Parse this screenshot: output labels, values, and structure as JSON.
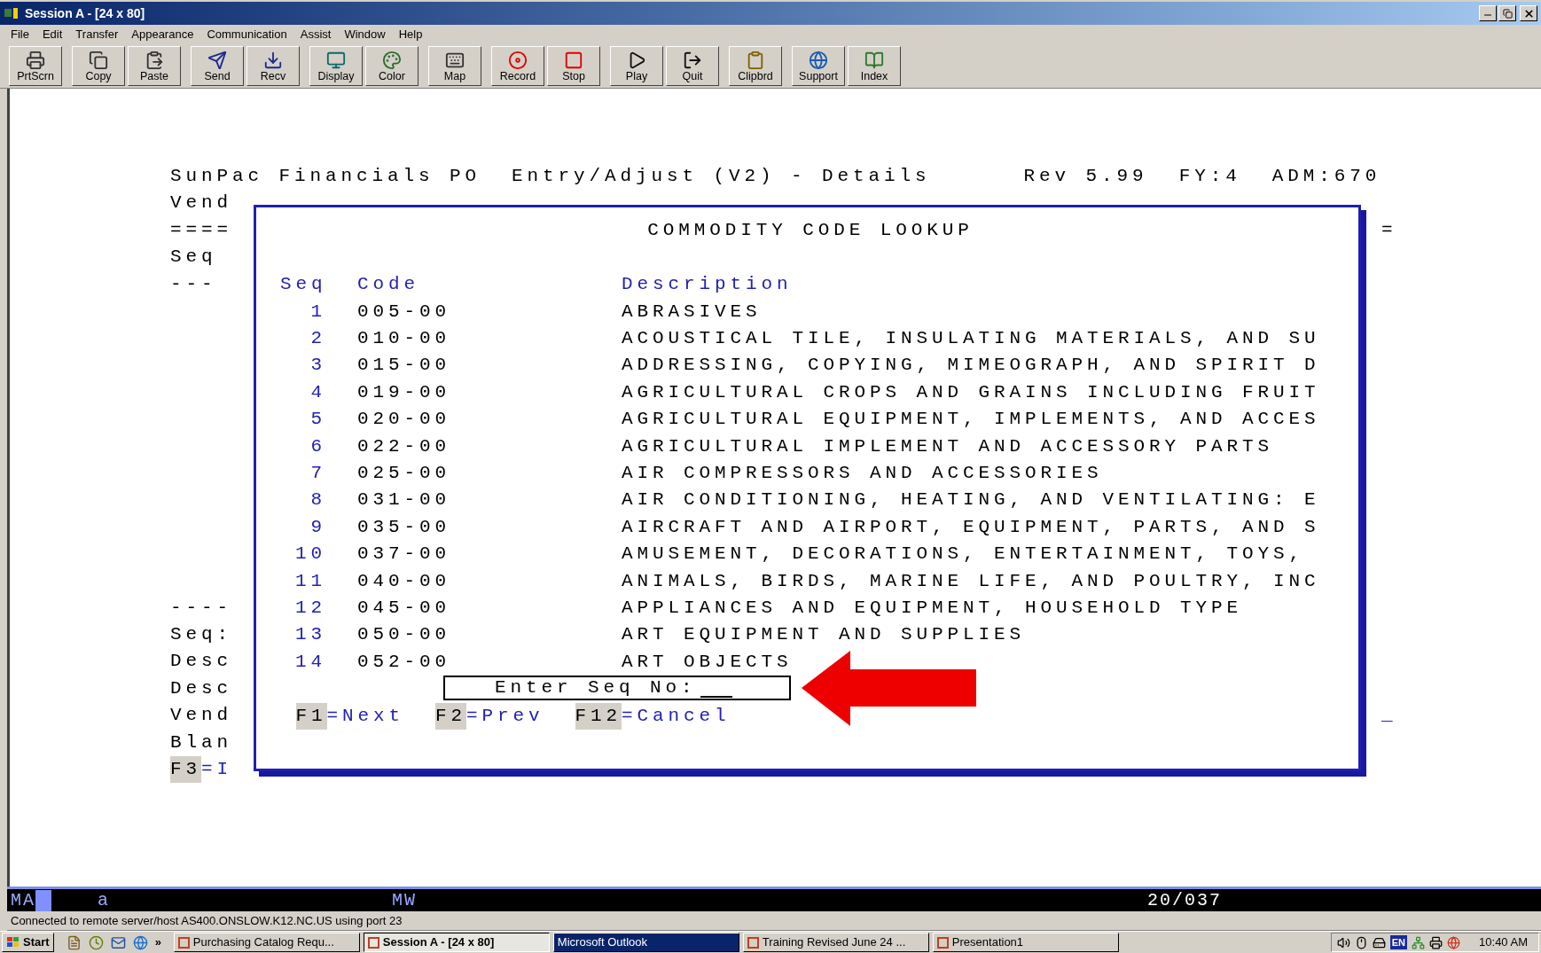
{
  "window": {
    "title": "Session A - [24 x 80]"
  },
  "menu": [
    "File",
    "Edit",
    "Transfer",
    "Appearance",
    "Communication",
    "Assist",
    "Window",
    "Help"
  ],
  "toolbar_groups": [
    {
      "buttons": [
        "PrtScrn"
      ]
    },
    {
      "buttons": [
        "Copy",
        "Paste"
      ]
    },
    {
      "buttons": [
        "Send",
        "Recv"
      ]
    },
    {
      "buttons": [
        "Display",
        "Color"
      ]
    },
    {
      "buttons": [
        "Map"
      ]
    },
    {
      "buttons": [
        "Record",
        "Stop"
      ]
    },
    {
      "buttons": [
        "Play",
        "Quit"
      ]
    },
    {
      "buttons": [
        "Clipbrd"
      ]
    },
    {
      "buttons": [
        "Support",
        "Index"
      ]
    }
  ],
  "screen": {
    "header": {
      "title": "SunPac Financials PO  Entry/Adjust (V2) - Details",
      "rev": "Rev 5.99",
      "fy": "FY:4",
      "adm": "ADM:670"
    },
    "upper_labels": [
      "Vend",
      "====",
      "Seq",
      "---"
    ],
    "lower_labels": [
      "----",
      "Seq:",
      "Desc",
      "Desc",
      "Vend",
      "Blan"
    ],
    "function_key": {
      "key": "F3",
      "action": "=I"
    },
    "right_marks": {
      "top": "=",
      "bottom": "_"
    },
    "lookup": {
      "title": "COMMODITY CODE LOOKUP",
      "columns": [
        "Seq",
        "Code",
        "Description"
      ],
      "rows": [
        {
          "seq": "1",
          "code": "005-00",
          "description": "ABRASIVES"
        },
        {
          "seq": "2",
          "code": "010-00",
          "description": "ACOUSTICAL TILE, INSULATING MATERIALS, AND SU"
        },
        {
          "seq": "3",
          "code": "015-00",
          "description": "ADDRESSING, COPYING, MIMEOGRAPH, AND SPIRIT D"
        },
        {
          "seq": "4",
          "code": "019-00",
          "description": "AGRICULTURAL CROPS AND GRAINS INCLUDING FRUIT"
        },
        {
          "seq": "5",
          "code": "020-00",
          "description": "AGRICULTURAL EQUIPMENT, IMPLEMENTS, AND ACCES"
        },
        {
          "seq": "6",
          "code": "022-00",
          "description": "AGRICULTURAL IMPLEMENT AND ACCESSORY PARTS"
        },
        {
          "seq": "7",
          "code": "025-00",
          "description": "AIR COMPRESSORS AND ACCESSORIES"
        },
        {
          "seq": "8",
          "code": "031-00",
          "description": "AIR CONDITIONING, HEATING, AND VENTILATING: E"
        },
        {
          "seq": "9",
          "code": "035-00",
          "description": "AIRCRAFT AND AIRPORT, EQUIPMENT, PARTS, AND S"
        },
        {
          "seq": "10",
          "code": "037-00",
          "description": "AMUSEMENT, DECORATIONS, ENTERTAINMENT, TOYS,"
        },
        {
          "seq": "11",
          "code": "040-00",
          "description": "ANIMALS, BIRDS, MARINE LIFE, AND POULTRY, INC"
        },
        {
          "seq": "12",
          "code": "045-00",
          "description": "APPLIANCES AND EQUIPMENT, HOUSEHOLD TYPE"
        },
        {
          "seq": "13",
          "code": "050-00",
          "description": "ART EQUIPMENT AND SUPPLIES"
        },
        {
          "seq": "14",
          "code": "052-00",
          "description": "ART OBJECTS"
        }
      ],
      "prompt": {
        "label": "Enter Seq No:"
      },
      "function_keys": [
        {
          "key": "F1",
          "action": "=Next"
        },
        {
          "key": "F2",
          "action": "=Prev"
        },
        {
          "key": "F12",
          "action": "=Cancel"
        }
      ]
    }
  },
  "status_line": {
    "mode": "MA",
    "insert": "a",
    "session": "MW",
    "position": "20/037"
  },
  "status_message": "Connected to remote server/host AS400.ONSLOW.K12.NC.US using port 23",
  "taskbar": {
    "start": "Start",
    "more": "»",
    "tasks": [
      {
        "label": "Purchasing Catalog Requ...",
        "selected": false,
        "flashing": false
      },
      {
        "label": "Session A - [24 x 80]",
        "selected": true,
        "flashing": false
      },
      {
        "label": "Microsoft Outlook",
        "selected": false,
        "flashing": true
      },
      {
        "label": "Training Revised June 24 ...",
        "selected": false,
        "flashing": false
      },
      {
        "label": "Presentation1",
        "selected": false,
        "flashing": false
      }
    ],
    "tray": {
      "language": "EN",
      "time": "10:40 AM"
    }
  }
}
